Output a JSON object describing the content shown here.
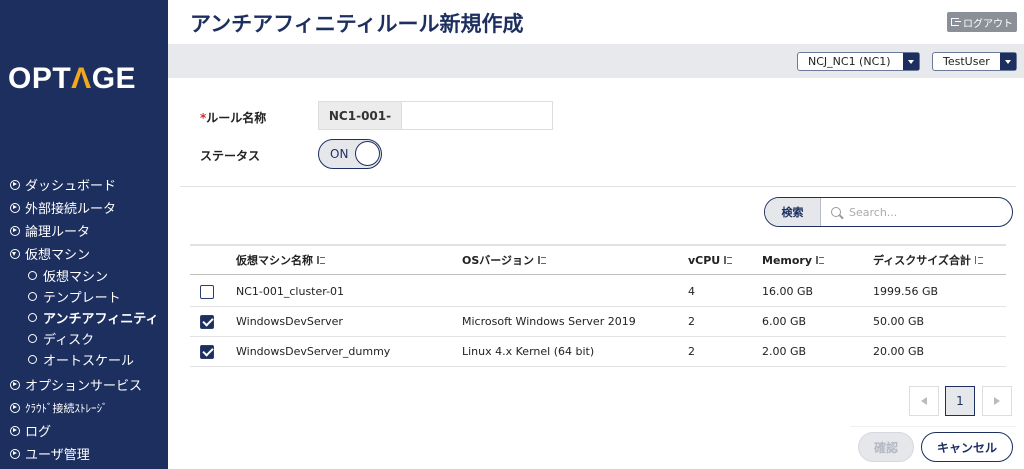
{
  "brand": {
    "logo_left": "OPT",
    "logo_accent": "Λ",
    "logo_right": "GE"
  },
  "sidebar": {
    "items": [
      {
        "label": "ダッシュボード",
        "expanded": false
      },
      {
        "label": "外部接続ルータ",
        "expanded": false
      },
      {
        "label": "論理ルータ",
        "expanded": false
      },
      {
        "label": "仮想マシン",
        "expanded": true
      },
      {
        "label": "オプションサービス",
        "expanded": false
      },
      {
        "label": "ｸﾗｳﾄﾞ接続ｽﾄﾚｰｼﾞ",
        "expanded": false
      },
      {
        "label": "ログ",
        "expanded": false
      },
      {
        "label": "ユーザ管理",
        "expanded": false
      }
    ],
    "subitems": [
      {
        "label": "仮想マシン",
        "active": false
      },
      {
        "label": "テンプレート",
        "active": false
      },
      {
        "label": "アンチアフィニティ",
        "active": true
      },
      {
        "label": "ディスク",
        "active": false
      },
      {
        "label": "オートスケール",
        "active": false
      }
    ]
  },
  "header": {
    "title": "アンチアフィニティルール新規作成",
    "logout_label": "ログアウト",
    "region_select": "NCJ_NC1 (NC1)",
    "user_select": "TestUser"
  },
  "form": {
    "rule_name_required_mark": "*",
    "rule_name_label": "ルール名称",
    "rule_name_prefix": "NC1-001-",
    "rule_name_value": "",
    "status_label": "ステータス",
    "status_toggle": "ON"
  },
  "search": {
    "button_label": "検索",
    "placeholder": "Search..."
  },
  "table": {
    "columns": [
      "仮想マシン名称",
      "OSバージョン",
      "vCPU",
      "Memory",
      "ディスクサイズ合計"
    ],
    "rows": [
      {
        "checked": false,
        "name": "NC1-001_cluster-01",
        "os": "",
        "vcpu": "4",
        "memory": "16.00 GB",
        "disk": "1999.56 GB"
      },
      {
        "checked": true,
        "name": "WindowsDevServer",
        "os": "Microsoft Windows Server 2019",
        "vcpu": "2",
        "memory": "6.00 GB",
        "disk": "50.00 GB"
      },
      {
        "checked": true,
        "name": "WindowsDevServer_dummy",
        "os": "Linux 4.x Kernel (64 bit)",
        "vcpu": "2",
        "memory": "2.00 GB",
        "disk": "20.00 GB"
      }
    ]
  },
  "pagination": {
    "current_page": "1"
  },
  "footer": {
    "confirm_label": "確認",
    "cancel_label": "キャンセル"
  }
}
